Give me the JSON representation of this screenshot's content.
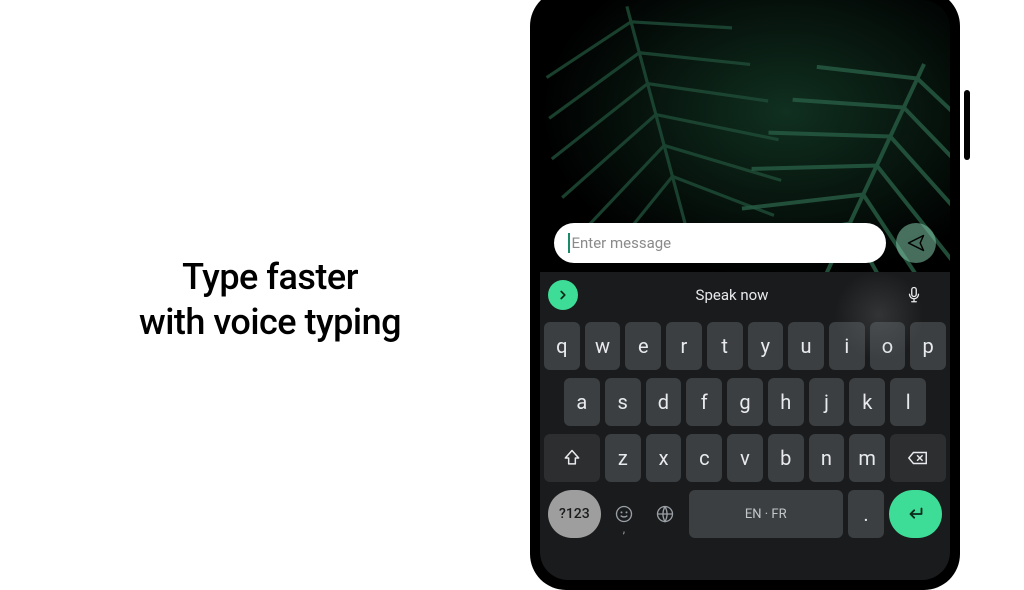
{
  "marketing": {
    "line1": "Type faster",
    "line2": "with voice typing"
  },
  "input": {
    "placeholder": "Enter message"
  },
  "keyboard": {
    "speak_label": "Speak now",
    "row1": [
      "q",
      "w",
      "e",
      "r",
      "t",
      "y",
      "u",
      "i",
      "o",
      "p"
    ],
    "row2": [
      "a",
      "s",
      "d",
      "f",
      "g",
      "h",
      "j",
      "k",
      "l"
    ],
    "row3": [
      "z",
      "x",
      "c",
      "v",
      "b",
      "n",
      "m"
    ],
    "symbols_label": "?123",
    "emoji_sub": ",",
    "space_label": "EN · FR",
    "period_label": "."
  },
  "colors": {
    "accent": "#3ddc97"
  }
}
